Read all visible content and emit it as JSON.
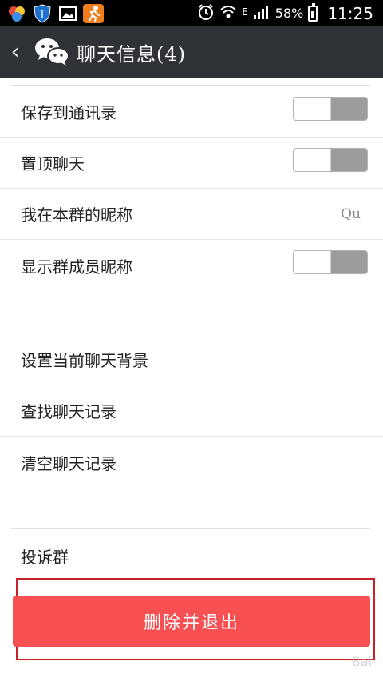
{
  "statusbar": {
    "battery": "58%",
    "time": "11:25",
    "network": "E",
    "icons": [
      "color-balls-icon",
      "shield-t-icon",
      "gallery-icon",
      "running-app-icon",
      "alarm-icon",
      "wifi-icon",
      "signal-icon",
      "battery-icon"
    ]
  },
  "actionbar": {
    "back_icon": "chevron-left-icon",
    "logo_icon": "wechat-logo-icon",
    "title": "聊天信息(4)"
  },
  "settings_group1": [
    {
      "label": "保存到通讯录",
      "control": "toggle",
      "on": false
    },
    {
      "label": "置顶聊天",
      "control": "toggle",
      "on": false
    },
    {
      "label": "我在本群的昵称",
      "control": "value",
      "value": "Qu"
    },
    {
      "label": "显示群成员昵称",
      "control": "toggle",
      "on": false
    }
  ],
  "settings_group2": [
    {
      "label": "设置当前聊天背景"
    },
    {
      "label": "查找聊天记录"
    },
    {
      "label": "清空聊天记录"
    }
  ],
  "settings_group3": [
    {
      "label": "投诉群"
    }
  ],
  "delete_button": {
    "label": "删除并退出",
    "color": "#f74f52"
  },
  "watermark": {
    "text": "Bai"
  }
}
